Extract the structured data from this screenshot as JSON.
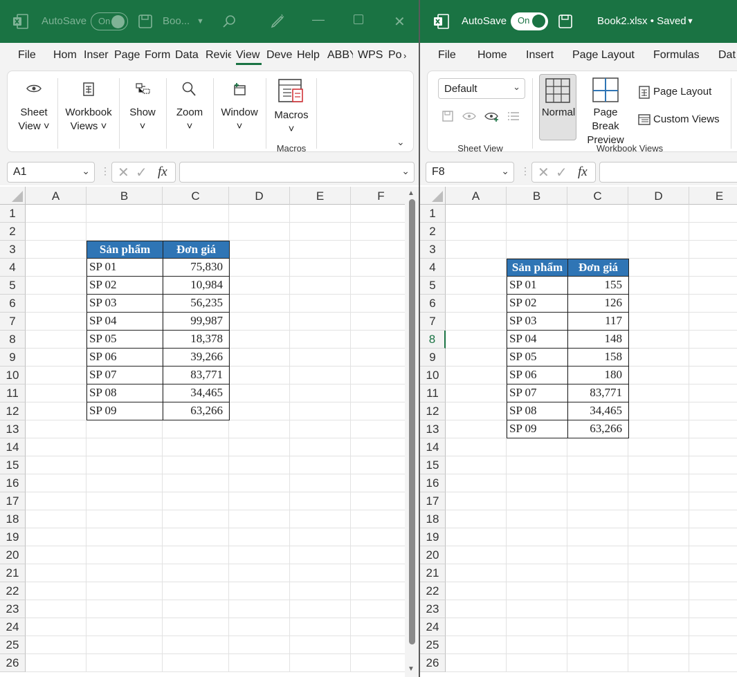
{
  "colors": {
    "title_bar": "#1a7343",
    "header_fill": "#2f75b5",
    "header_text": "#ffffff"
  },
  "left": {
    "title": {
      "autosave": "AutoSave",
      "toggle": "On",
      "filename": "Boo..."
    },
    "tabs": [
      "File",
      "Hom",
      "Inser",
      "Page",
      "Form",
      "Data",
      "Revie",
      "View",
      "Deve",
      "Help",
      "ABBY",
      "WPS",
      "Po"
    ],
    "selected_tab": "View",
    "ribbon": {
      "sheet_view": "Sheet\nView ˅",
      "workbook_views": "Workbook\nViews ˅",
      "show": "Show\n˅",
      "zoom": "Zoom\n˅",
      "window": "Window\n˅",
      "macros": "Macros\n˅",
      "macros_group": "Macros"
    },
    "namebox": "A1",
    "fx": "fx",
    "columns": [
      "A",
      "B",
      "C",
      "D",
      "E",
      "F"
    ],
    "rows": [
      "1",
      "2",
      "3",
      "4",
      "5",
      "6",
      "7",
      "8",
      "9",
      "10",
      "11",
      "12",
      "13",
      "14",
      "15",
      "16",
      "17",
      "18",
      "19",
      "20",
      "21",
      "22",
      "23",
      "24",
      "25",
      "26"
    ],
    "table": {
      "headers": [
        "Sản phẩm",
        "Đơn giá"
      ],
      "rows": [
        [
          "SP 01",
          "75,830"
        ],
        [
          "SP 02",
          "10,984"
        ],
        [
          "SP 03",
          "56,235"
        ],
        [
          "SP 04",
          "99,987"
        ],
        [
          "SP 05",
          "18,378"
        ],
        [
          "SP 06",
          "39,266"
        ],
        [
          "SP 07",
          "83,771"
        ],
        [
          "SP 08",
          "34,465"
        ],
        [
          "SP 09",
          "63,266"
        ]
      ]
    }
  },
  "right": {
    "title": {
      "autosave": "AutoSave",
      "toggle": "On",
      "filename": "Book2.xlsx • Saved"
    },
    "tabs": [
      "File",
      "Home",
      "Insert",
      "Page Layout",
      "Formulas",
      "Dat"
    ],
    "ribbon": {
      "view_select": "Default",
      "sheet_view_group": "Sheet View",
      "normal": "Normal",
      "page_break": "Page Break\nPreview",
      "page_layout": "Page Layout",
      "custom_views": "Custom Views",
      "workbook_views_group": "Workbook Views"
    },
    "namebox": "F8",
    "fx": "fx",
    "columns": [
      "A",
      "B",
      "C",
      "D",
      "E"
    ],
    "rows": [
      "1",
      "2",
      "3",
      "4",
      "5",
      "6",
      "7",
      "8",
      "9",
      "10",
      "11",
      "12",
      "13",
      "14",
      "15",
      "16",
      "17",
      "18",
      "19",
      "20",
      "21",
      "22",
      "23",
      "24",
      "25",
      "26"
    ],
    "selected_row": "8",
    "table": {
      "headers": [
        "Sản phẩm",
        "Đơn giá"
      ],
      "rows": [
        [
          "SP 01",
          "155"
        ],
        [
          "SP 02",
          "126"
        ],
        [
          "SP 03",
          "117"
        ],
        [
          "SP 04",
          "148"
        ],
        [
          "SP 05",
          "158"
        ],
        [
          "SP 06",
          "180"
        ],
        [
          "SP 07",
          "83,771"
        ],
        [
          "SP 08",
          "34,465"
        ],
        [
          "SP 09",
          "63,266"
        ]
      ]
    }
  }
}
